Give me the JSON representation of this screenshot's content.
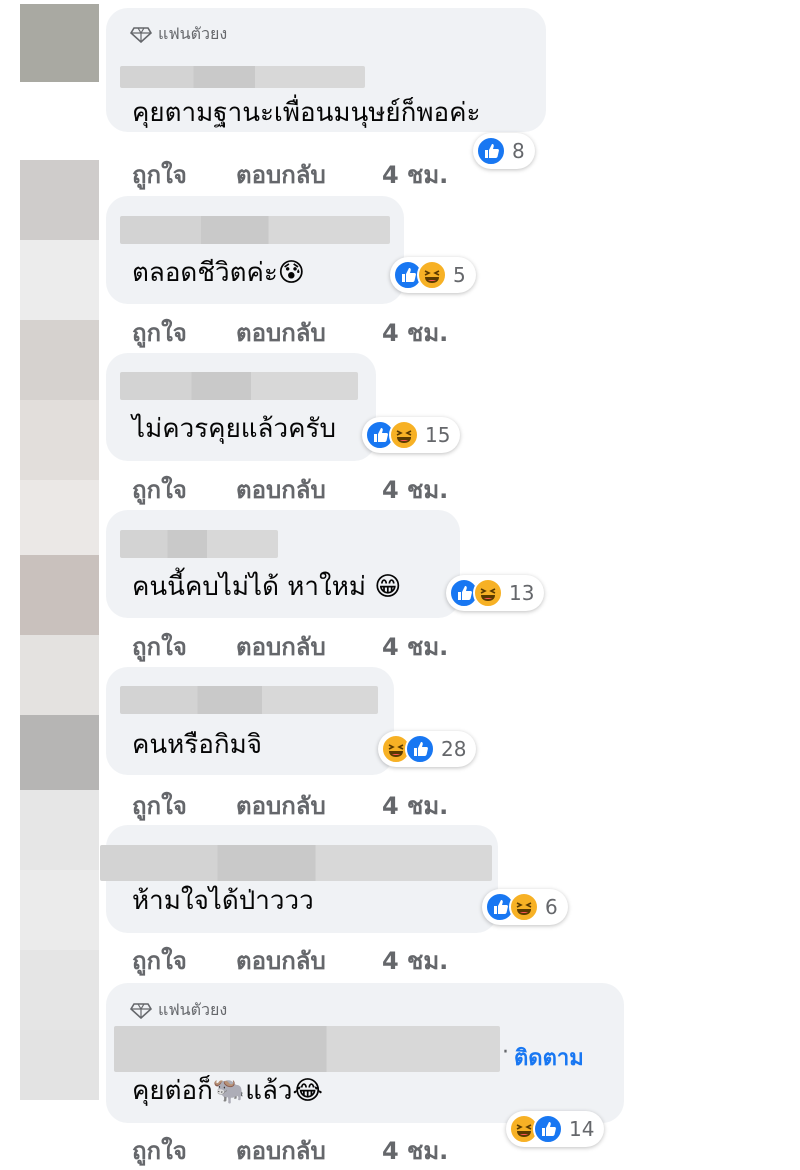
{
  "comments": [
    {
      "badge": "แฟนตัวยง",
      "text": "คุยตามฐานะเพื่อนมนุษย์ก็พอค่ะ",
      "reaction_count": "8",
      "reactions": [
        "like"
      ]
    },
    {
      "text": "ตลอดชีวิตค่ะ😰",
      "reaction_count": "5",
      "reactions": [
        "like",
        "haha"
      ]
    },
    {
      "text": "ไม่ควรคุยแล้วครับ",
      "reaction_count": "15",
      "reactions": [
        "like",
        "haha"
      ]
    },
    {
      "text": "คนนี้คบไม่ได้ หาใหม่ 😁",
      "reaction_count": "13",
      "reactions": [
        "like",
        "haha"
      ]
    },
    {
      "text": "คนหรือกิมจิ",
      "reaction_count": "28",
      "reactions": [
        "haha",
        "like"
      ]
    },
    {
      "text": "ห้ามใจได้ป่าววว",
      "reaction_count": "6",
      "reactions": [
        "like",
        "haha"
      ]
    },
    {
      "badge": "แฟนตัวยง",
      "follow": "ติดตาม",
      "text": "คุยต่อก็🐃แล้ว😂",
      "reaction_count": "14",
      "reactions": [
        "haha",
        "like"
      ]
    }
  ],
  "actions": {
    "like": "ถูกใจ",
    "reply": "ตอบกลับ",
    "time": "4 ชม."
  },
  "colors": {
    "like": "#1877f2",
    "haha": "#f7b125",
    "bubble": "#f0f2f5",
    "meta": "#65676b"
  }
}
